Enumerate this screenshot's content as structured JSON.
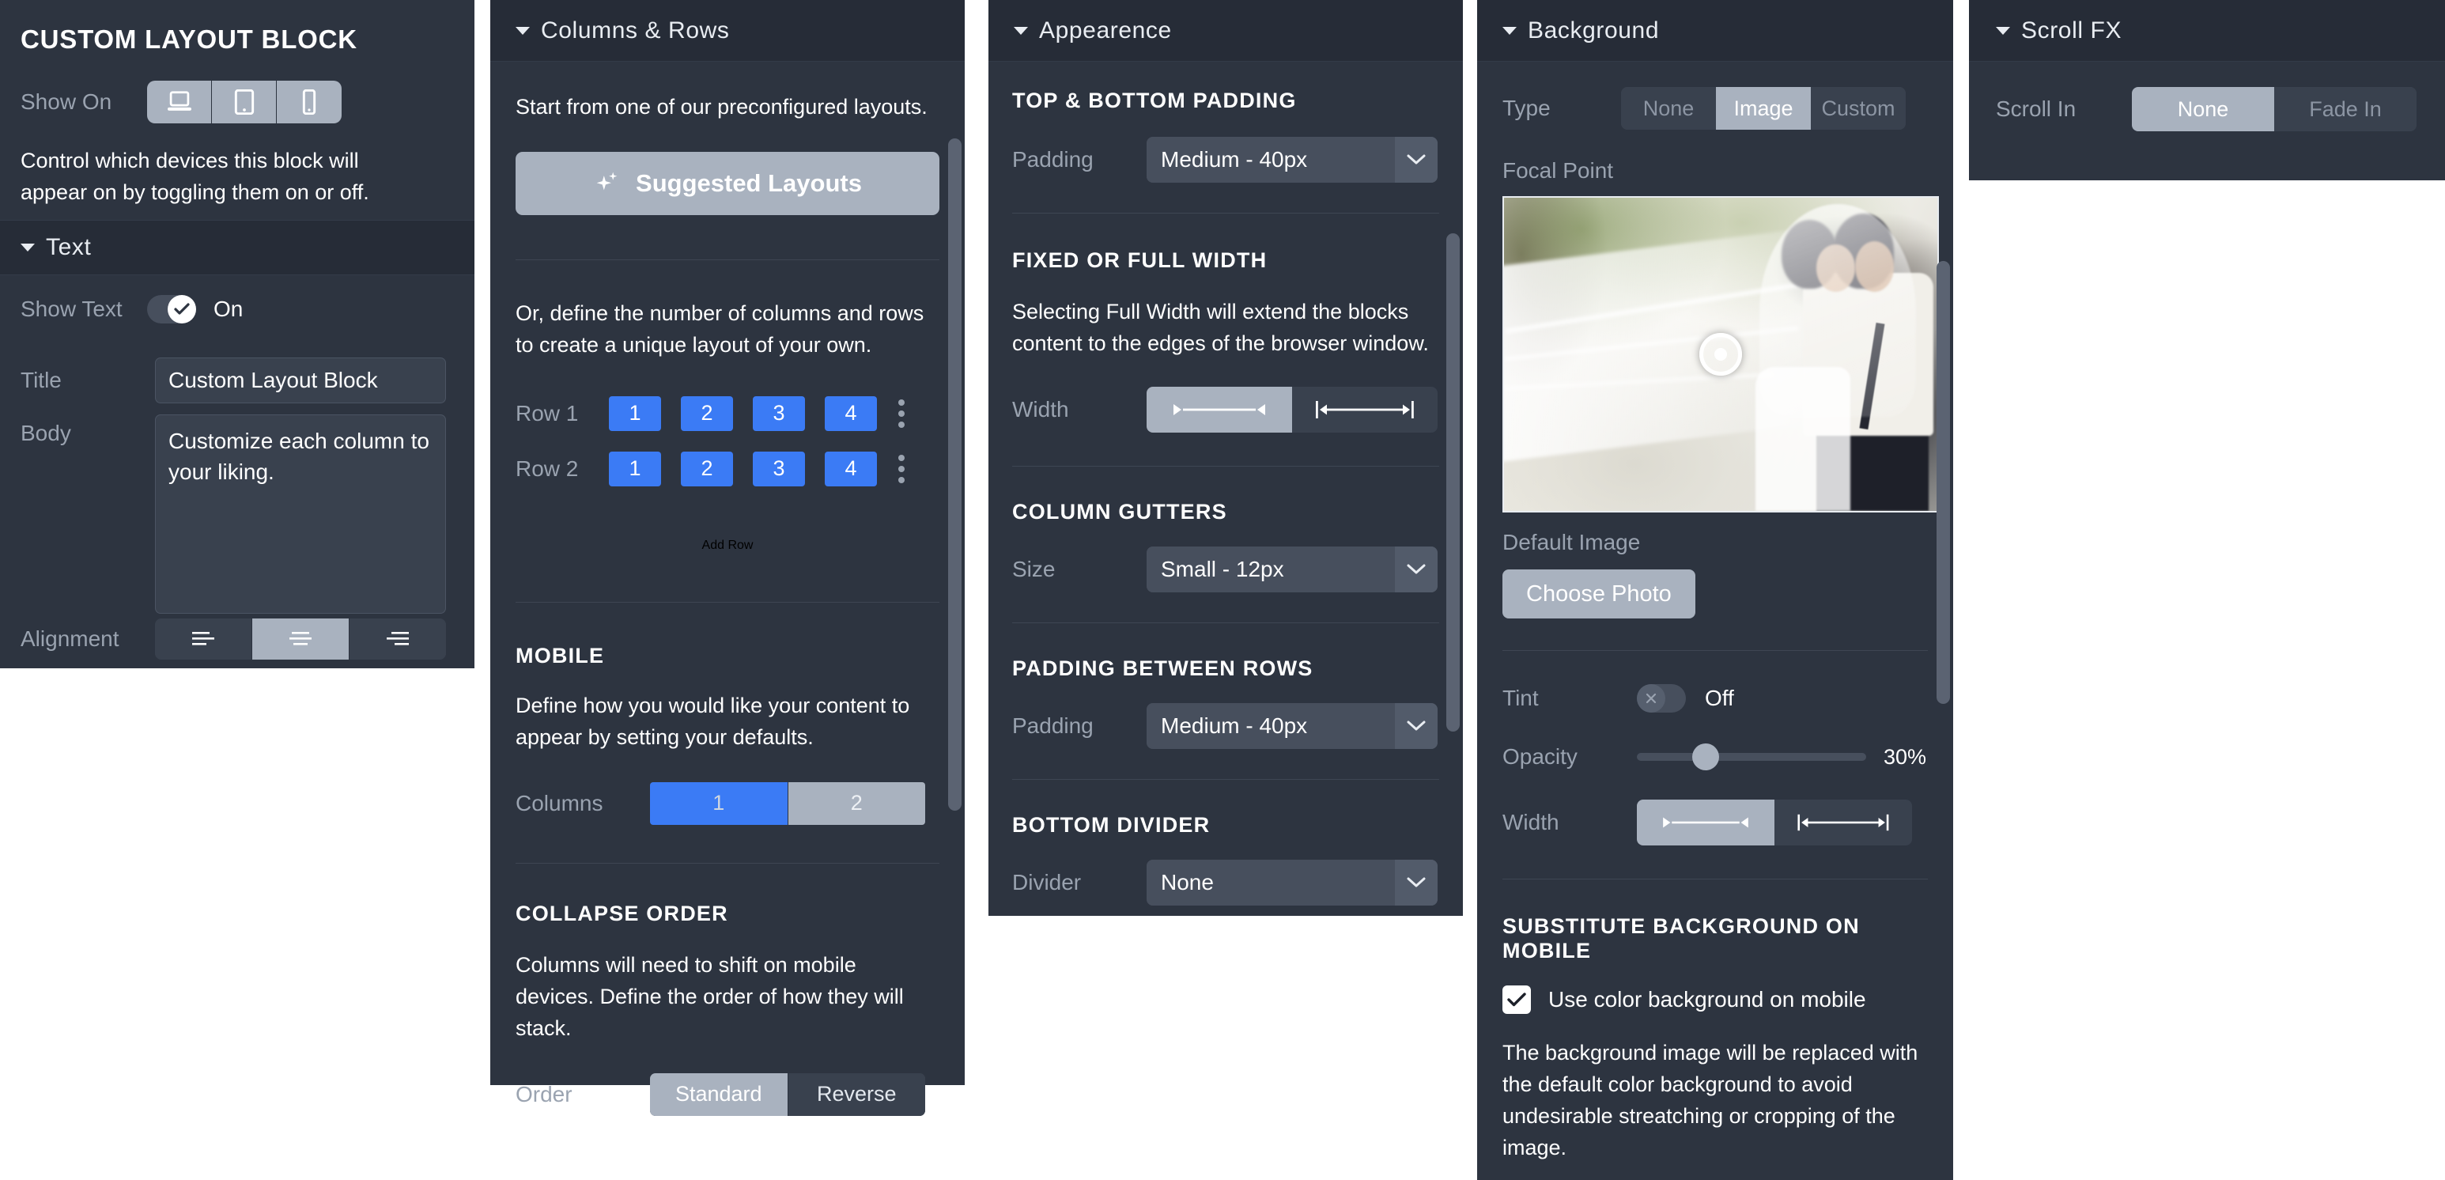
{
  "panels": {
    "block": {
      "title": "CUSTOM LAYOUT BLOCK",
      "show_on_label": "Show On",
      "devices": [
        {
          "name": "laptop",
          "state": "on"
        },
        {
          "name": "tablet",
          "state": "on"
        },
        {
          "name": "phone",
          "state": "on"
        }
      ],
      "description": "Control which devices this block will appear on by toggling them on or off.",
      "text_section": {
        "header": "Text",
        "show_text_label": "Show Text",
        "show_text_value": "On",
        "title_label": "Title",
        "title_value": "Custom Layout Block",
        "body_label": "Body",
        "body_value": "Customize each column to your liking.",
        "alignment_label": "Alignment",
        "alignment_options": [
          "align-left",
          "align-center",
          "align-right"
        ],
        "alignment_selected": "align-center"
      }
    },
    "columns_rows": {
      "header": "Columns & Rows",
      "intro": "Start from one of our preconfigured layouts.",
      "suggested_button": "Suggested Layouts",
      "define_text": "Or, define the number of columns and rows to create a unique layout of your own.",
      "rows": [
        {
          "label": "Row 1",
          "cells": [
            "1",
            "2",
            "3",
            "4"
          ]
        },
        {
          "label": "Row 2",
          "cells": [
            "1",
            "2",
            "3",
            "4"
          ]
        }
      ],
      "add_row": "Add Row",
      "mobile_header": "MOBILE",
      "mobile_text": "Define how you would like your content to appear by setting your defaults.",
      "columns_label": "Columns",
      "columns_options": [
        "1",
        "2"
      ],
      "columns_selected": "1",
      "collapse_header": "COLLAPSE ORDER",
      "collapse_text": "Columns will need to shift on mobile devices. Define the order of how they will stack.",
      "order_label": "Order",
      "order_options": [
        "Standard",
        "Reverse"
      ],
      "order_selected": "Standard"
    },
    "appearance": {
      "header": "Appearence",
      "top_bottom_padding_header": "TOP & BOTTOM PADDING",
      "padding_label": "Padding",
      "padding_value": "Medium - 40px",
      "fixed_full_header": "FIXED OR FULL WIDTH",
      "fixed_full_text": "Selecting Full Width will extend the blocks content to the edges of the browser window.",
      "width_label": "Width",
      "width_options": [
        "fixed-width",
        "full-width"
      ],
      "width_selected": "fixed-width",
      "gutters_header": "COLUMN GUTTERS",
      "size_label": "Size",
      "size_value": "Small - 12px",
      "padding_rows_header": "PADDING BETWEEN ROWS",
      "padding_rows_label": "Padding",
      "padding_rows_value": "Medium - 40px",
      "bottom_divider_header": "BOTTOM DIVIDER",
      "divider_label": "Divider",
      "divider_value": "None"
    },
    "background": {
      "header": "Background",
      "type_label": "Type",
      "type_options": [
        "None",
        "Image",
        "Custom"
      ],
      "type_selected": "Image",
      "focal_point_label": "Focal Point",
      "default_image_label": "Default Image",
      "choose_photo_button": "Choose Photo",
      "tint_label": "Tint",
      "tint_value": "Off",
      "opacity_label": "Opacity",
      "opacity_value": "30%",
      "opacity_percent": 30,
      "width_label": "Width",
      "width_options": [
        "fixed-width",
        "full-width"
      ],
      "width_selected": "fixed-width",
      "substitute_header": "SUBSTITUTE BACKGROUND ON MOBILE",
      "substitute_checkbox_label": "Use color background on mobile",
      "substitute_checked": true,
      "substitute_text": "The background image will be replaced with the default color background to avoid undesirable streatching or cropping of the image."
    },
    "scroll_fx": {
      "header": "Scroll FX",
      "scroll_in_label": "Scroll In",
      "scroll_in_options": [
        "None",
        "Fade In"
      ],
      "scroll_in_selected": "None"
    }
  },
  "colors": {
    "panel_bg": "#2d3440",
    "panel_head_bg": "#262c37",
    "accent_blue": "#3b7bf5",
    "selected_gray": "#a9b2bf",
    "muted_text": "#9aa3b0"
  }
}
